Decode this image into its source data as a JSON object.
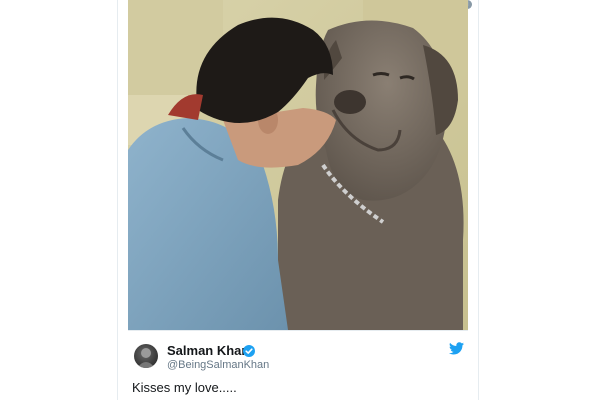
{
  "tweet": {
    "author": {
      "display_name": "Salman Khan",
      "handle": "@BeingSalmanKhan",
      "verified": true
    },
    "text": "Kisses my love.....",
    "media": {
      "type": "photo"
    },
    "icons": {
      "info": "info-icon",
      "verified": "verified-badge-icon",
      "brand": "twitter-bird-icon"
    },
    "colors": {
      "brand_blue": "#1da1f2",
      "name_text": "#14171a",
      "handle_text": "#657786"
    }
  }
}
